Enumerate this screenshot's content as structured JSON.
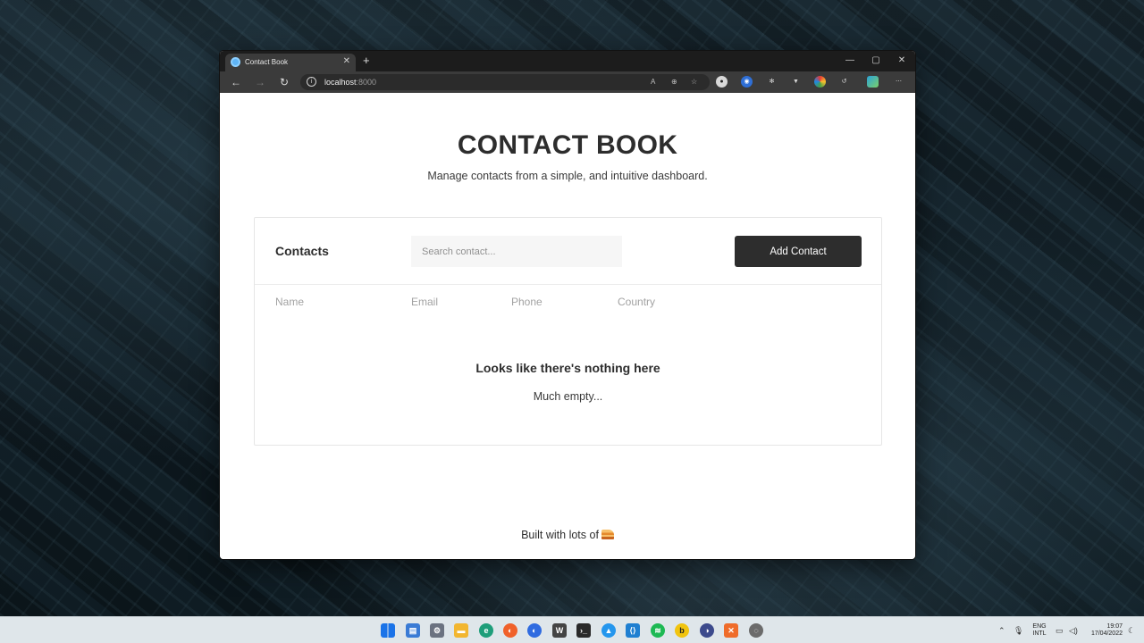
{
  "browser": {
    "tab_title": "Contact Book",
    "tab_close": "✕",
    "new_tab": "+",
    "address_host": "localhost",
    "address_port": ":8000",
    "window_controls": {
      "minimize": "—",
      "maximize": "▢",
      "close": "✕"
    }
  },
  "page": {
    "title": "CONTACT BOOK",
    "subtitle": "Manage contacts from a simple, and intuitive dashboard."
  },
  "contacts": {
    "heading": "Contacts",
    "search_placeholder": "Search contact...",
    "add_button": "Add Contact",
    "columns": [
      "Name",
      "Email",
      "Phone",
      "Country"
    ],
    "empty_title": "Looks like there's nothing here",
    "empty_subtitle": "Much empty..."
  },
  "footer": {
    "text": "Built with lots of"
  },
  "taskbar": {
    "language": "ENG",
    "layout": "INTL",
    "time": "19:07",
    "date": "17/04/2022"
  },
  "colors": {
    "accent_dark": "#2d2d2d",
    "page_background": "#ffffff",
    "browser_chrome": "#3b3b3b"
  }
}
